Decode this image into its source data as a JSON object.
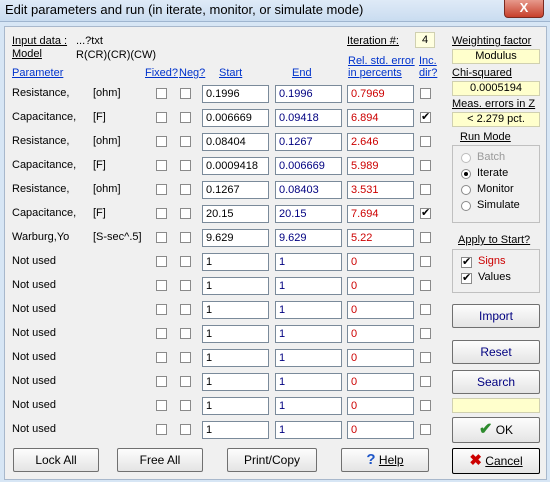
{
  "window": {
    "title": "Edit parameters and run (in iterate, monitor, or simulate mode)",
    "close_glyph": "X"
  },
  "header": {
    "input_data_label": "Input data :",
    "input_data_value": "...?txt",
    "model_label": "Model",
    "model_value": "R(CR)(CR)(CW)",
    "iteration_label": "Iteration #:",
    "iteration_value": "4"
  },
  "columns": {
    "parameter": "Parameter",
    "fixed": "Fixed?",
    "neg": "Neg?",
    "start": "Start",
    "end": "End",
    "err_line1": "Rel. std. error",
    "err_line2": "in percents",
    "inc_line1": "Inc.",
    "inc_line2": "dir?"
  },
  "rows": [
    {
      "name": "Resistance,",
      "unit": "[ohm]",
      "fixed": false,
      "neg": false,
      "start": "0.1996",
      "end": "0.1996",
      "err": "0.7969",
      "inc": false
    },
    {
      "name": "Capacitance,",
      "unit": "[F]",
      "fixed": false,
      "neg": false,
      "start": "0.006669",
      "end": "0.09418",
      "err": "6.894",
      "inc": true
    },
    {
      "name": "Resistance,",
      "unit": "[ohm]",
      "fixed": false,
      "neg": false,
      "start": "0.08404",
      "end": "0.1267",
      "err": "2.646",
      "inc": false
    },
    {
      "name": "Capacitance,",
      "unit": "[F]",
      "fixed": false,
      "neg": false,
      "start": "0.0009418",
      "end": "0.006669",
      "err": "5.989",
      "inc": false
    },
    {
      "name": "Resistance,",
      "unit": "[ohm]",
      "fixed": false,
      "neg": false,
      "start": "0.1267",
      "end": "0.08403",
      "err": "3.531",
      "inc": false
    },
    {
      "name": "Capacitance,",
      "unit": "[F]",
      "fixed": false,
      "neg": false,
      "start": "20.15",
      "end": "20.15",
      "err": "7.694",
      "inc": true
    },
    {
      "name": "Warburg,Yo",
      "unit": "[S-sec^.5]",
      "fixed": false,
      "neg": false,
      "start": "9.629",
      "end": "9.629",
      "err": "5.22",
      "inc": false
    },
    {
      "name": "Not used",
      "unit": "",
      "fixed": false,
      "neg": false,
      "start": "1",
      "end": "1",
      "err": "0",
      "inc": false
    },
    {
      "name": "Not used",
      "unit": "",
      "fixed": false,
      "neg": false,
      "start": "1",
      "end": "1",
      "err": "0",
      "inc": false
    },
    {
      "name": "Not used",
      "unit": "",
      "fixed": false,
      "neg": false,
      "start": "1",
      "end": "1",
      "err": "0",
      "inc": false
    },
    {
      "name": "Not used",
      "unit": "",
      "fixed": false,
      "neg": false,
      "start": "1",
      "end": "1",
      "err": "0",
      "inc": false
    },
    {
      "name": "Not used",
      "unit": "",
      "fixed": false,
      "neg": false,
      "start": "1",
      "end": "1",
      "err": "0",
      "inc": false
    },
    {
      "name": "Not used",
      "unit": "",
      "fixed": false,
      "neg": false,
      "start": "1",
      "end": "1",
      "err": "0",
      "inc": false
    },
    {
      "name": "Not used",
      "unit": "",
      "fixed": false,
      "neg": false,
      "start": "1",
      "end": "1",
      "err": "0",
      "inc": false
    },
    {
      "name": "Not used",
      "unit": "",
      "fixed": false,
      "neg": false,
      "start": "1",
      "end": "1",
      "err": "0",
      "inc": false
    }
  ],
  "side": {
    "weighting_label": "Weighting factor",
    "weighting_value": "Modulus",
    "chi_label": "Chi-squared",
    "chi_value": "0.0005194",
    "meas_label": "Meas. errors in Z",
    "meas_value": "< 2.279 pct.",
    "run_mode_label": "Run Mode",
    "run_modes": [
      {
        "label": "Batch",
        "selected": false,
        "disabled": true
      },
      {
        "label": "Iterate",
        "selected": true,
        "disabled": false
      },
      {
        "label": "Monitor",
        "selected": false,
        "disabled": false
      },
      {
        "label": "Simulate",
        "selected": false,
        "disabled": false
      }
    ],
    "apply_label": "Apply to Start?",
    "apply_signs": "Signs",
    "apply_values": "Values",
    "import_label": "Import",
    "reset_label": "Reset",
    "search_label": "Search",
    "ok_label": "OK",
    "cancel_label": "Cancel"
  },
  "bottom": {
    "lock_all": "Lock All",
    "free_all": "Free All",
    "print_copy": "Print/Copy",
    "help": "Help"
  }
}
